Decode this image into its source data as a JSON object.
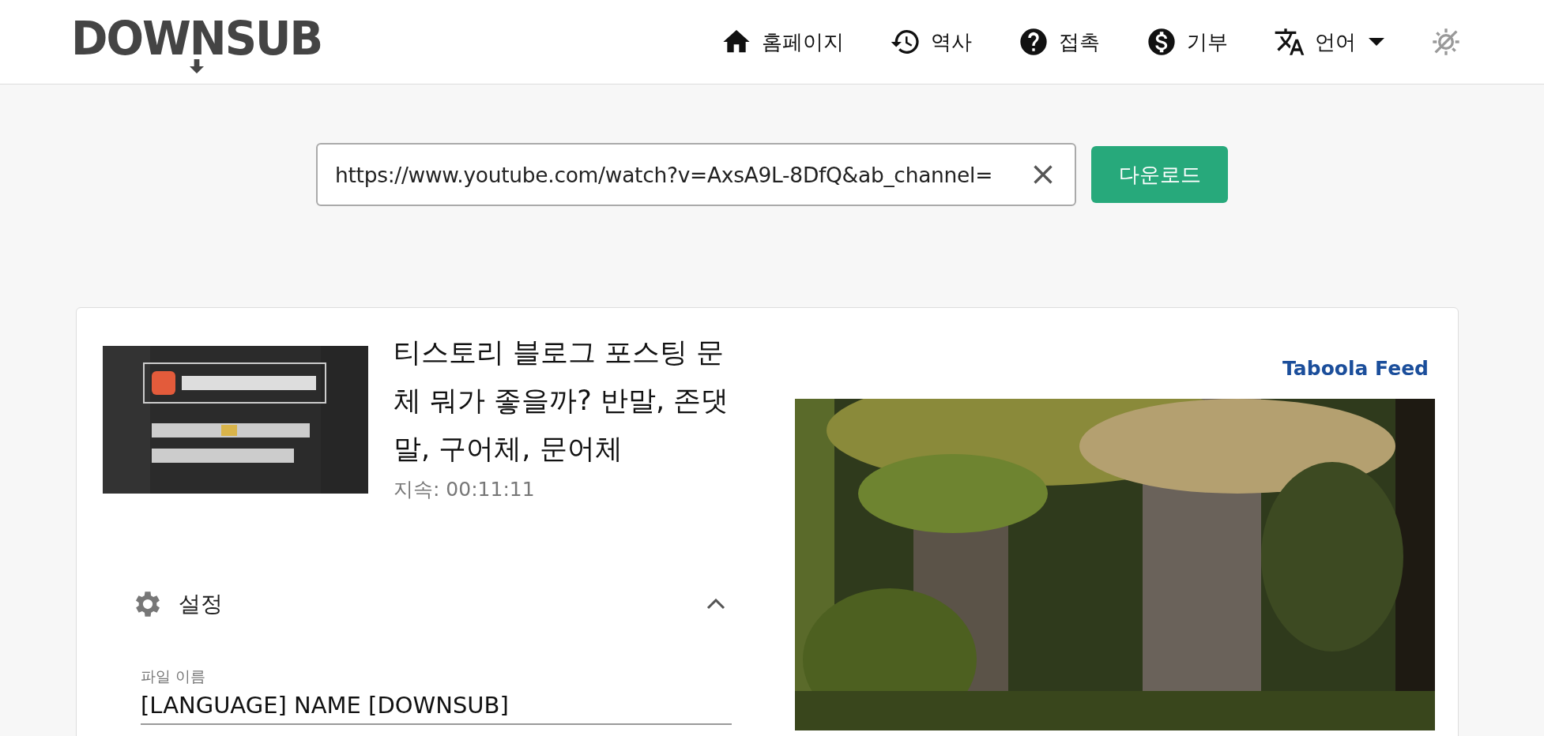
{
  "header": {
    "logo": "DOWNSUB",
    "nav": [
      {
        "kind": "home",
        "label": "홈페이지",
        "dropdown": false
      },
      {
        "kind": "history",
        "label": "역사",
        "dropdown": false
      },
      {
        "kind": "help",
        "label": "접촉",
        "dropdown": false
      },
      {
        "kind": "donate",
        "label": "기부",
        "dropdown": false
      },
      {
        "kind": "language",
        "label": "언어",
        "dropdown": true
      }
    ]
  },
  "search": {
    "value": "https://www.youtube.com/watch?v=AxsA9L-8DfQ&ab_channel=",
    "button": "다운로드"
  },
  "video": {
    "title": "티스토리 블로그 포스팅 문체 뭐가 좋을까? 반말, 존댓말, 구어체, 문어체",
    "duration": "지속: 00:11:11"
  },
  "settings": {
    "label": "설정",
    "expanded": true,
    "field_label": "파일 이름",
    "field_value": "[LANGUAGE] NAME [DOWNSUB]"
  },
  "ad": {
    "label": "Taboola Feed"
  }
}
